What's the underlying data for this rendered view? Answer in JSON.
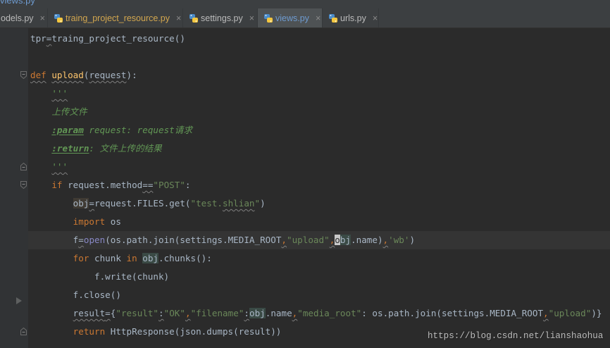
{
  "nav_bar": {
    "file": "views.py"
  },
  "tab_file_icon": "python-file-icon",
  "tabs": [
    {
      "label": "odels.py",
      "close": "×",
      "color": "#BBBBBB",
      "active": false
    },
    {
      "label": "traing_project_resource.py",
      "close": "×",
      "color": "#D3A74F",
      "active": false
    },
    {
      "label": "settings.py",
      "close": "×",
      "color": "#BBBBBB",
      "active": false
    },
    {
      "label": "views.py",
      "close": "×",
      "color": "#6E9BD0",
      "active": true
    },
    {
      "label": "urls.py",
      "close": "×",
      "color": "#BBBBBB",
      "active": false
    }
  ],
  "editor": {
    "background": "#2B2B2B",
    "lines": [
      {
        "tokens": [
          {
            "text": "tpr",
            "color": "#A9B7C6"
          },
          {
            "text": "=",
            "color": "#A9B7C6",
            "squiggle": true
          },
          {
            "text": "traing_project_resource()",
            "color": "#A9B7C6"
          }
        ]
      },
      {
        "tokens": []
      },
      {
        "gutter_icon": "fold-start-icon",
        "tokens": [
          {
            "text": "def",
            "color": "#CC7832",
            "squiggle": true
          },
          {
            "text": " ",
            "color": "#A9B7C6"
          },
          {
            "text": "upload",
            "color": "#FFC66D",
            "squiggle": true
          },
          {
            "text": "(",
            "color": "#A9B7C6"
          },
          {
            "text": "request",
            "color": "#A9B7C6",
            "squiggle": true
          },
          {
            "text": "):",
            "color": "#A9B7C6"
          }
        ]
      },
      {
        "tokens": [
          {
            "text": "    ",
            "color": "#A9B7C6"
          },
          {
            "text": "'''",
            "color": "#629755",
            "italic": true,
            "squiggle": true
          }
        ]
      },
      {
        "tokens": [
          {
            "text": "    上传文件",
            "color": "#629755",
            "italic": true
          }
        ]
      },
      {
        "tokens": [
          {
            "text": "    ",
            "color": "#A9B7C6"
          },
          {
            "text": ":param",
            "color": "#629755",
            "italic": true,
            "bold": true,
            "underline": true
          },
          {
            "text": " request: request请求",
            "color": "#629755",
            "italic": true
          }
        ]
      },
      {
        "tokens": [
          {
            "text": "    ",
            "color": "#A9B7C6"
          },
          {
            "text": ":return",
            "color": "#629755",
            "italic": true,
            "bold": true,
            "underline": true
          },
          {
            "text": ": 文件上传的结果",
            "color": "#629755",
            "italic": true
          }
        ]
      },
      {
        "gutter_icon": "fold-end-icon",
        "tokens": [
          {
            "text": "    ",
            "color": "#A9B7C6"
          },
          {
            "text": "'''",
            "color": "#629755",
            "italic": true,
            "squiggle": true
          }
        ]
      },
      {
        "gutter_icon": "fold-start-icon",
        "tokens": [
          {
            "text": "    ",
            "color": "#A9B7C6"
          },
          {
            "text": "if",
            "color": "#CC7832"
          },
          {
            "text": " request.method",
            "color": "#A9B7C6"
          },
          {
            "text": "==",
            "color": "#A9B7C6",
            "squiggle": true
          },
          {
            "text": "\"POST\"",
            "color": "#6A8759"
          },
          {
            "text": ":",
            "color": "#A9B7C6"
          }
        ]
      },
      {
        "tokens": [
          {
            "text": "        ",
            "color": "#A9B7C6"
          },
          {
            "text": "obj",
            "color": "#A9B7C6",
            "bg": "#3F3A33"
          },
          {
            "text": "=",
            "color": "#A9B7C6",
            "squiggle": true
          },
          {
            "text": "request.FILES.get(",
            "color": "#A9B7C6"
          },
          {
            "text": "\"test.",
            "color": "#6A8759"
          },
          {
            "text": "shlian",
            "color": "#6A8759",
            "squiggle": true
          },
          {
            "text": "\"",
            "color": "#6A8759"
          },
          {
            "text": ")",
            "color": "#A9B7C6"
          }
        ]
      },
      {
        "tokens": [
          {
            "text": "        ",
            "color": "#A9B7C6"
          },
          {
            "text": "import",
            "color": "#CC7832"
          },
          {
            "text": " os",
            "color": "#A9B7C6"
          }
        ]
      },
      {
        "current": true,
        "tokens": [
          {
            "text": "        ",
            "color": "#A9B7C6"
          },
          {
            "text": "f",
            "color": "#A9B7C6"
          },
          {
            "text": "=",
            "color": "#A9B7C6",
            "squiggle": true
          },
          {
            "text": "open",
            "color": "#8888C6"
          },
          {
            "text": "(os.path.join(settings.MEDIA_ROOT",
            "color": "#A9B7C6"
          },
          {
            "text": ",",
            "color": "#CC7832",
            "squiggle": true
          },
          {
            "text": "\"upload\"",
            "color": "#6A8759"
          },
          {
            "text": ",",
            "color": "#CC7832",
            "squiggle": true
          },
          {
            "text": "o",
            "color": "#2B2B2B",
            "bg": "#C8C8C8"
          },
          {
            "text": "bj",
            "color": "#A9B7C6",
            "bg": "#3A4A45"
          },
          {
            "text": ".name)",
            "color": "#A9B7C6"
          },
          {
            "text": ",",
            "color": "#CC7832",
            "squiggle": true
          },
          {
            "text": "'wb'",
            "color": "#6A8759"
          },
          {
            "text": ")",
            "color": "#A9B7C6"
          }
        ]
      },
      {
        "tokens": [
          {
            "text": "        ",
            "color": "#A9B7C6"
          },
          {
            "text": "for",
            "color": "#CC7832"
          },
          {
            "text": " chunk ",
            "color": "#A9B7C6"
          },
          {
            "text": "in",
            "color": "#CC7832"
          },
          {
            "text": " ",
            "color": "#A9B7C6"
          },
          {
            "text": "obj",
            "color": "#A9B7C6",
            "bg": "#3A4A45"
          },
          {
            "text": ".chunks():",
            "color": "#A9B7C6"
          }
        ]
      },
      {
        "tokens": [
          {
            "text": "            f.write(chunk)",
            "color": "#A9B7C6"
          }
        ]
      },
      {
        "gutter_icon": "expand-triangle-icon",
        "tokens": [
          {
            "text": "        f.close()",
            "color": "#A9B7C6"
          }
        ]
      },
      {
        "tokens": [
          {
            "text": "        ",
            "color": "#A9B7C6"
          },
          {
            "text": "result",
            "color": "#A9B7C6",
            "squiggle": true
          },
          {
            "text": "=",
            "color": "#A9B7C6",
            "squiggle": true
          },
          {
            "text": "{",
            "color": "#A9B7C6"
          },
          {
            "text": "\"result\"",
            "color": "#6A8759"
          },
          {
            "text": ":",
            "color": "#A9B7C6",
            "squiggle": true
          },
          {
            "text": "\"OK\"",
            "color": "#6A8759"
          },
          {
            "text": ",",
            "color": "#CC7832",
            "squiggle": true
          },
          {
            "text": "\"filename\"",
            "color": "#6A8759"
          },
          {
            "text": ":",
            "color": "#A9B7C6",
            "squiggle": true
          },
          {
            "text": "obj",
            "color": "#A9B7C6",
            "bg": "#3A4A45"
          },
          {
            "text": ".name",
            "color": "#A9B7C6"
          },
          {
            "text": ",",
            "color": "#CC7832",
            "squiggle": true
          },
          {
            "text": "\"media_root\"",
            "color": "#6A8759"
          },
          {
            "text": ": os.path.join(settings.MEDIA_ROOT",
            "color": "#A9B7C6"
          },
          {
            "text": ",",
            "color": "#CC7832",
            "squiggle": true
          },
          {
            "text": "\"upload\"",
            "color": "#6A8759"
          },
          {
            "text": ")}",
            "color": "#A9B7C6"
          }
        ]
      },
      {
        "gutter_icon": "fold-end-icon",
        "tokens": [
          {
            "text": "        ",
            "color": "#A9B7C6"
          },
          {
            "text": "return",
            "color": "#CC7832"
          },
          {
            "text": " HttpResponse(json.dumps(result))",
            "color": "#A9B7C6"
          }
        ]
      }
    ]
  },
  "watermark": "https://blog.csdn.net/lianshaohua"
}
